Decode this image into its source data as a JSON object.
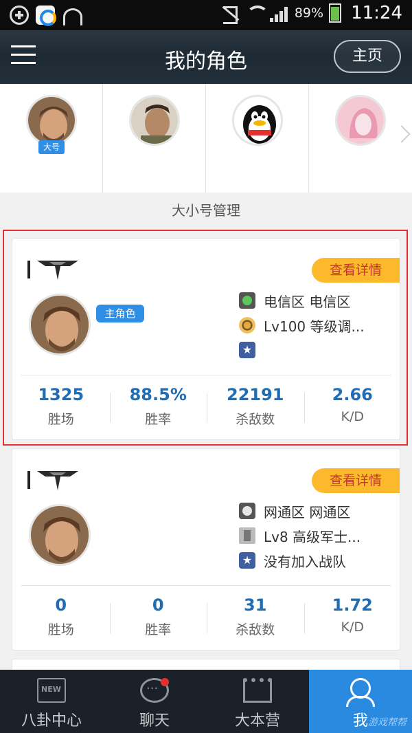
{
  "status_bar": {
    "battery": "89%",
    "time": "11:24"
  },
  "header": {
    "title": "我的角色",
    "home_label": "主页"
  },
  "accounts": [
    {
      "badge": "大号",
      "avatar": "warrior-avatar"
    },
    {
      "badge": "",
      "avatar": "soldier-avatar"
    },
    {
      "badge": "",
      "avatar": "qq-penguin-avatar"
    },
    {
      "badge": "",
      "avatar": "pink-avatar"
    }
  ],
  "manage_label": "大小号管理",
  "roles": [
    {
      "detail_label": "查看详情",
      "main_tag": "主角色",
      "server": "电信区 电信区",
      "level": "Lv100  等级调...",
      "team": "",
      "stats": [
        {
          "value": "1325",
          "label": "胜场"
        },
        {
          "value": "88.5%",
          "label": "胜率"
        },
        {
          "value": "22191",
          "label": "杀敌数"
        },
        {
          "value": "2.66",
          "label": "K/D"
        }
      ]
    },
    {
      "detail_label": "查看详情",
      "main_tag": "",
      "server": "网通区 网通区",
      "level": "Lv8  高级军士...",
      "team": "没有加入战队",
      "stats": [
        {
          "value": "0",
          "label": "胜场"
        },
        {
          "value": "0",
          "label": "胜率"
        },
        {
          "value": "31",
          "label": "杀敌数"
        },
        {
          "value": "1.72",
          "label": "K/D"
        }
      ]
    }
  ],
  "bottom_nav": [
    {
      "label": "八卦中心",
      "icon": "news-icon"
    },
    {
      "label": "聊天",
      "icon": "chat-icon"
    },
    {
      "label": "大本营",
      "icon": "castle-icon"
    },
    {
      "label": "我",
      "icon": "user-icon"
    }
  ],
  "watermark": "游戏帮帮",
  "colors": {
    "accent": "#2a8ae0",
    "detail_button": "#fbb92b",
    "highlight_border": "#e53030"
  }
}
